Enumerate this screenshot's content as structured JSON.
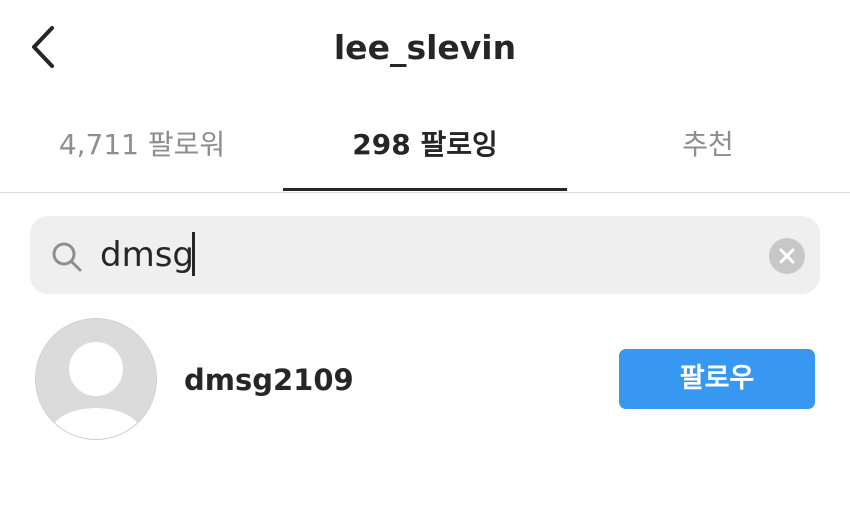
{
  "header": {
    "title": "lee_slevin",
    "back_icon": "chevron-left-icon"
  },
  "tabs": [
    {
      "label": "4,711 팔로워",
      "active": false
    },
    {
      "label": "298 팔로잉",
      "active": true
    },
    {
      "label": "추천",
      "active": false
    }
  ],
  "search": {
    "value": "dmsg",
    "icon": "search-icon",
    "clear_icon": "clear-icon"
  },
  "results": [
    {
      "username": "dmsg2109",
      "avatar": "default-avatar-icon",
      "button_label": "팔로우"
    }
  ],
  "colors": {
    "accent": "#3897f0",
    "text": "#262626",
    "muted": "#8e8e8e",
    "search_bg": "#efefef"
  }
}
